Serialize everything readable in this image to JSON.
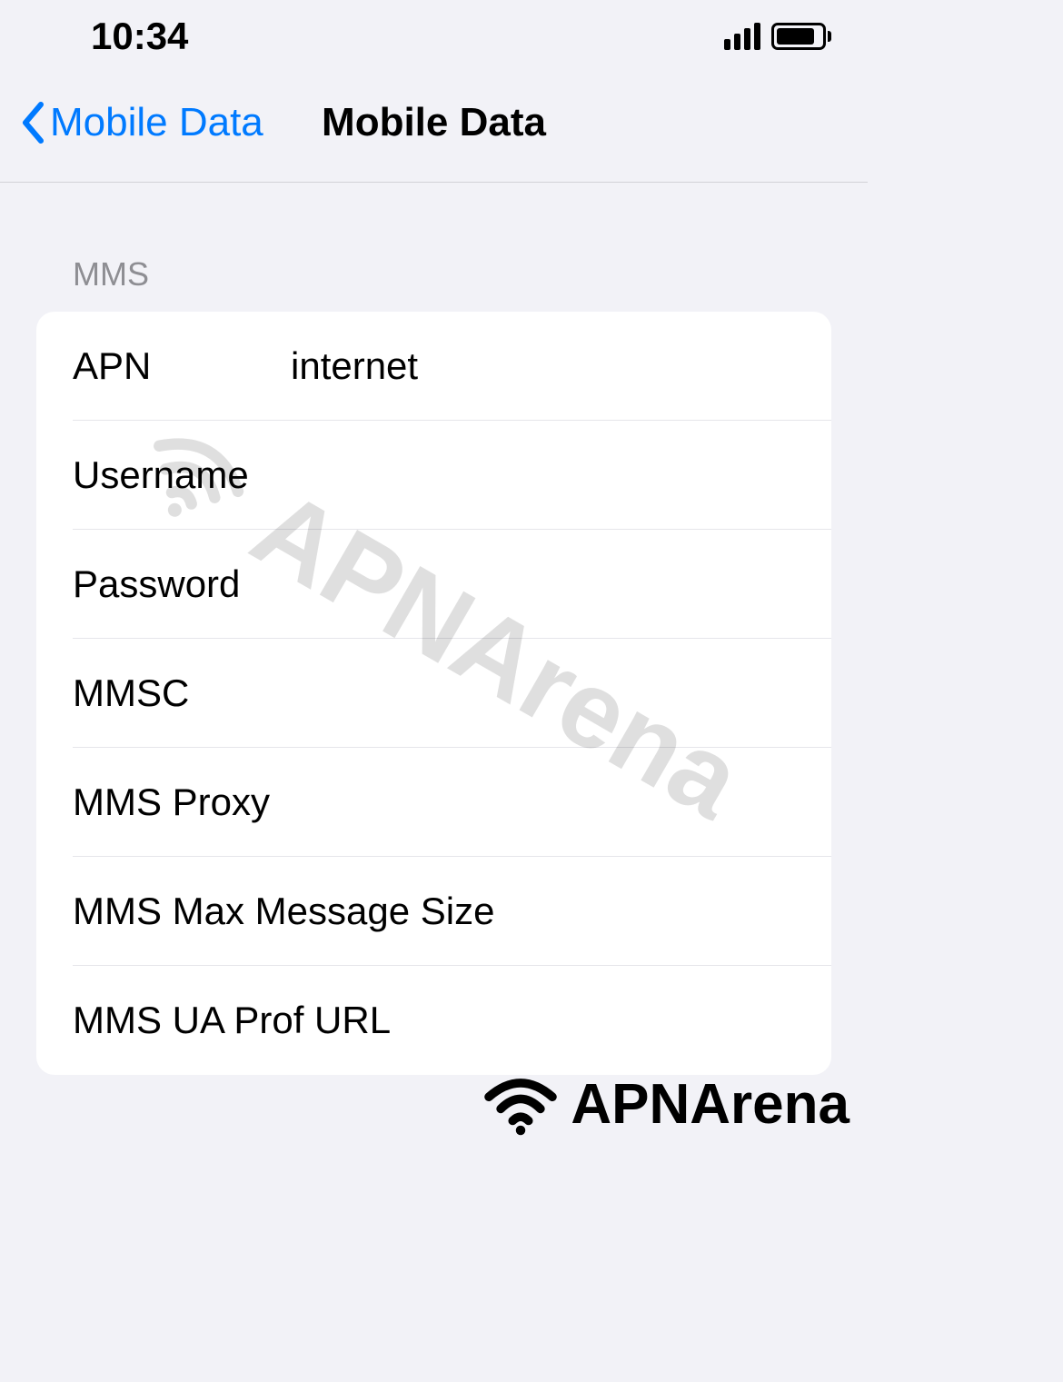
{
  "statusBar": {
    "time": "10:34"
  },
  "navBar": {
    "backLabel": "Mobile Data",
    "title": "Mobile Data"
  },
  "sectionHeader": "MMS",
  "rows": [
    {
      "label": "APN",
      "value": "internet"
    },
    {
      "label": "Username",
      "value": ""
    },
    {
      "label": "Password",
      "value": ""
    },
    {
      "label": "MMSC",
      "value": ""
    },
    {
      "label": "MMS Proxy",
      "value": ""
    },
    {
      "label": "MMS Max Message Size",
      "value": ""
    },
    {
      "label": "MMS UA Prof URL",
      "value": ""
    }
  ],
  "watermark": {
    "text": "APNArena"
  }
}
